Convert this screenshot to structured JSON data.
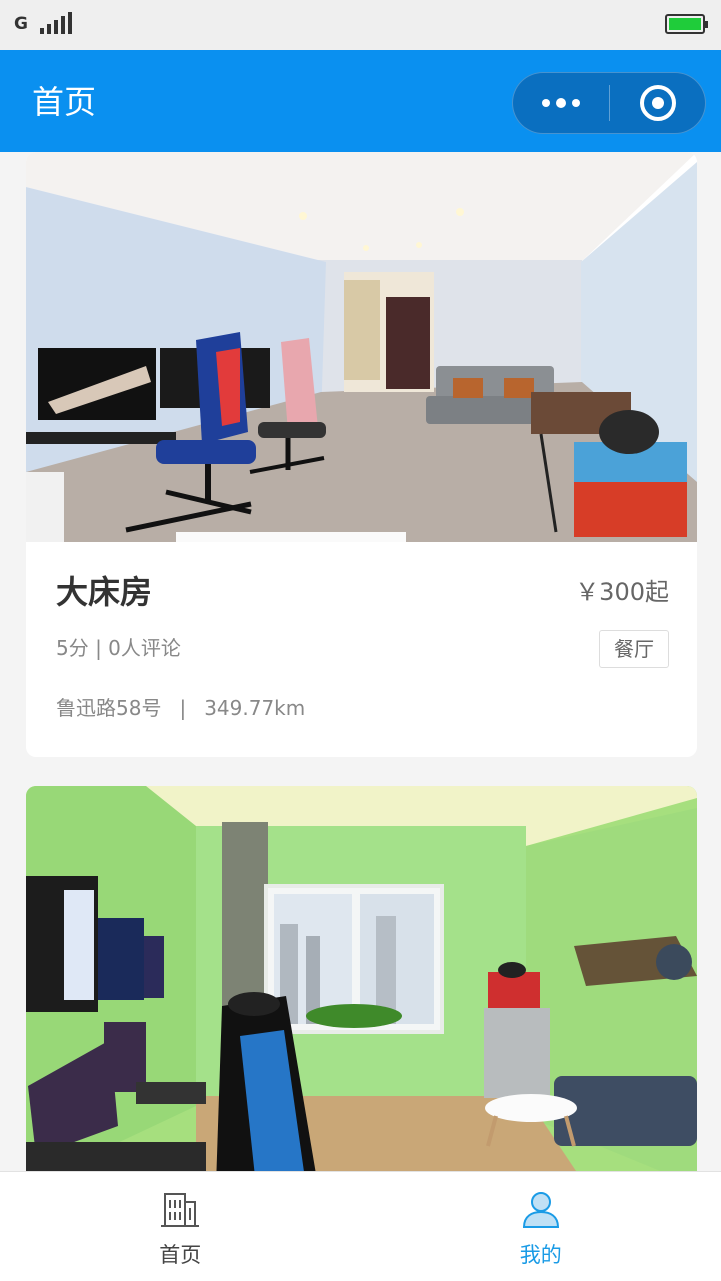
{
  "status_bar": {
    "network_type": "G",
    "signal_icon": "signal-bars-icon",
    "battery_icon": "battery-full-icon",
    "battery_color": "#1fcc3a"
  },
  "nav_bar": {
    "title": "首页",
    "background": "#0a90f0",
    "more_icon": "more-dots-icon",
    "close_icon": "target-circle-icon"
  },
  "listings": [
    {
      "image_icon": "room-photo-gaming-room",
      "title": "大床房",
      "price": "￥300起",
      "rating": "5分 | 0人评论",
      "tag": "餐厅",
      "address": "鲁迅路58号",
      "separator": "|",
      "distance": "349.77km"
    },
    {
      "image_icon": "room-photo-green-gaming-room"
    }
  ],
  "tab_bar": {
    "items": [
      {
        "label": "首页",
        "icon": "building-icon",
        "active": false
      },
      {
        "label": "我的",
        "icon": "user-icon",
        "active": true
      }
    ],
    "active_color": "#1a9be6"
  }
}
